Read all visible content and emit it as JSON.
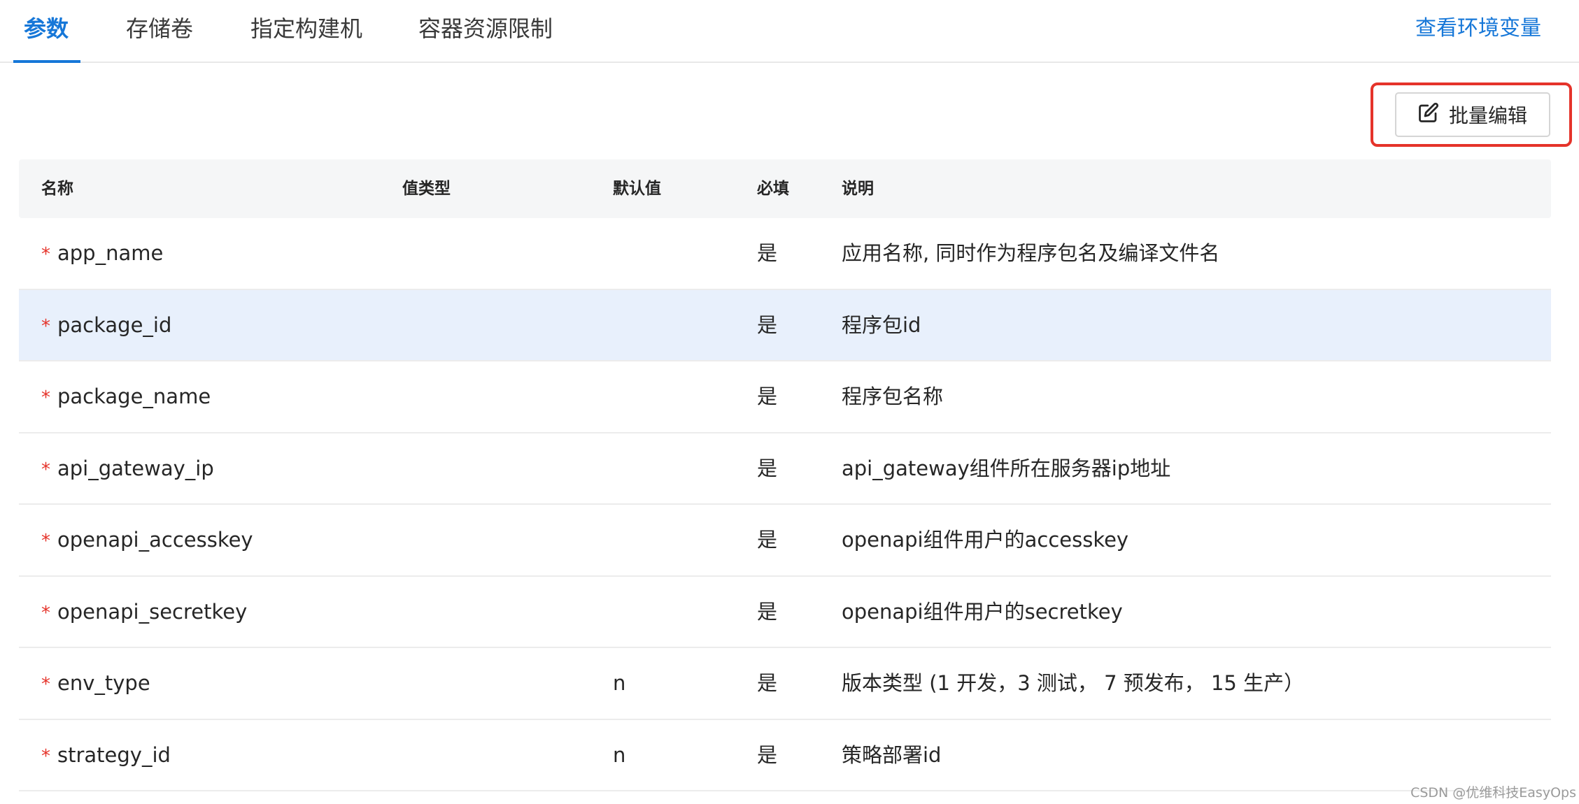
{
  "tabs": [
    {
      "label": "参数",
      "active": true
    },
    {
      "label": "存储卷",
      "active": false
    },
    {
      "label": "指定构建机",
      "active": false
    },
    {
      "label": "容器资源限制",
      "active": false
    }
  ],
  "env_link": "查看环境变量",
  "batch_edit": {
    "label": "批量编辑",
    "icon": "edit-icon"
  },
  "table": {
    "headers": {
      "name": "名称",
      "type": "值类型",
      "default": "默认值",
      "required": "必填",
      "desc": "说明"
    },
    "required_mark": "*",
    "rows": [
      {
        "name": "app_name",
        "type": "",
        "default": "",
        "required": "是",
        "desc": "应用名称, 同时作为程序包名及编译文件名"
      },
      {
        "name": "package_id",
        "type": "",
        "default": "",
        "required": "是",
        "desc": "程序包id"
      },
      {
        "name": "package_name",
        "type": "",
        "default": "",
        "required": "是",
        "desc": "程序包名称"
      },
      {
        "name": "api_gateway_ip",
        "type": "",
        "default": "",
        "required": "是",
        "desc": "api_gateway组件所在服务器ip地址"
      },
      {
        "name": "openapi_accesskey",
        "type": "",
        "default": "",
        "required": "是",
        "desc": "openapi组件用户的accesskey"
      },
      {
        "name": "openapi_secretkey",
        "type": "",
        "default": "",
        "required": "是",
        "desc": "openapi组件用户的secretkey"
      },
      {
        "name": "env_type",
        "type": "",
        "default": "n",
        "required": "是",
        "desc": "版本类型 (1 开发，3 测试， 7 预发布， 15 生产）"
      },
      {
        "name": "strategy_id",
        "type": "",
        "default": "n",
        "required": "是",
        "desc": "策略部署id"
      }
    ]
  },
  "watermark": "CSDN @优维科技EasyOps",
  "colors": {
    "accent": "#1677d8",
    "highlight_border": "#e5332a",
    "selected_row": "#e8f0fc",
    "required_star": "#e5332a"
  }
}
